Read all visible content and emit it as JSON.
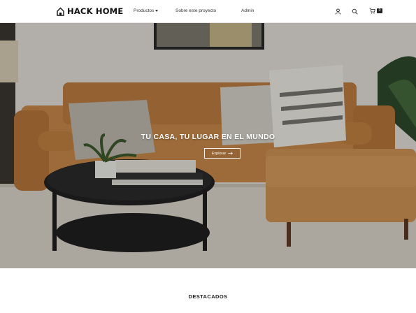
{
  "brand": {
    "name": "HACK HOME",
    "icon": "house-icon"
  },
  "nav": {
    "products": "Productos",
    "about": "Sobre este proyecto",
    "admin": "Admin"
  },
  "actions": {
    "user_icon": "user-icon",
    "search_icon": "search-icon",
    "cart_icon": "cart-icon",
    "cart_count": "0"
  },
  "hero": {
    "title": "TU CASA, TU LUGAR EN EL MUNDO",
    "button_label": "Explorar"
  },
  "featured": {
    "title": "DESTACADOS"
  },
  "colors": {
    "brand_text": "#111111",
    "sofa": "#c98a4a",
    "overlay": "#000000",
    "button_border": "#ffffff"
  }
}
